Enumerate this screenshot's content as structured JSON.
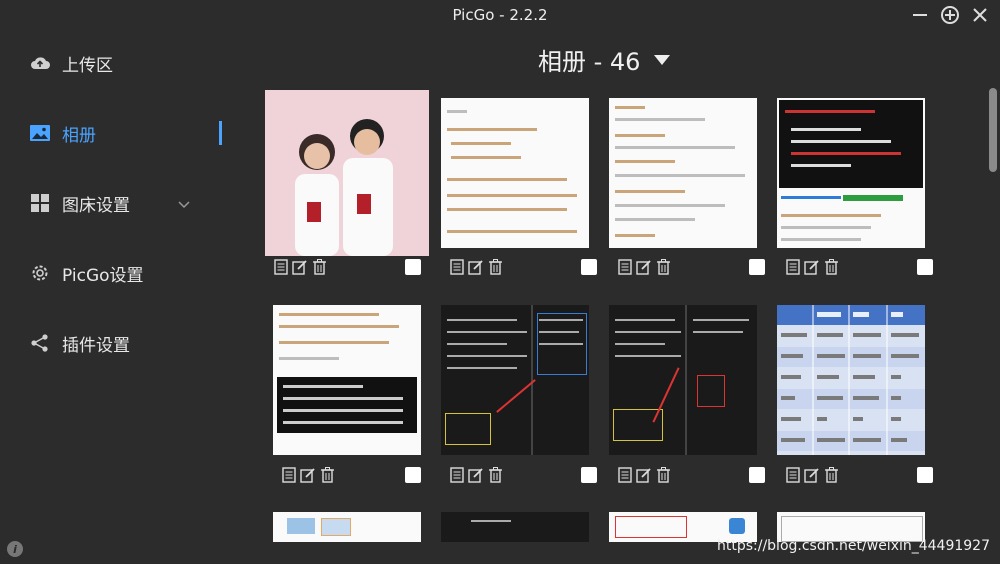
{
  "window": {
    "title": "PicGo - 2.2.2"
  },
  "sidebar": {
    "items": [
      {
        "label": "上传区",
        "icon": "cloud-upload-icon"
      },
      {
        "label": "相册",
        "icon": "image-icon",
        "active": true
      },
      {
        "label": "图床设置",
        "icon": "grid-icon",
        "has_submenu": true
      },
      {
        "label": "PicGo设置",
        "icon": "gear-icon"
      },
      {
        "label": "插件设置",
        "icon": "share-icon"
      }
    ]
  },
  "album": {
    "title": "相册 - 46"
  },
  "watermark": "https://blog.csdn.net/weixin_44491927",
  "colors": {
    "accent": "#4aa3ff",
    "background": "#2c2c2c"
  }
}
